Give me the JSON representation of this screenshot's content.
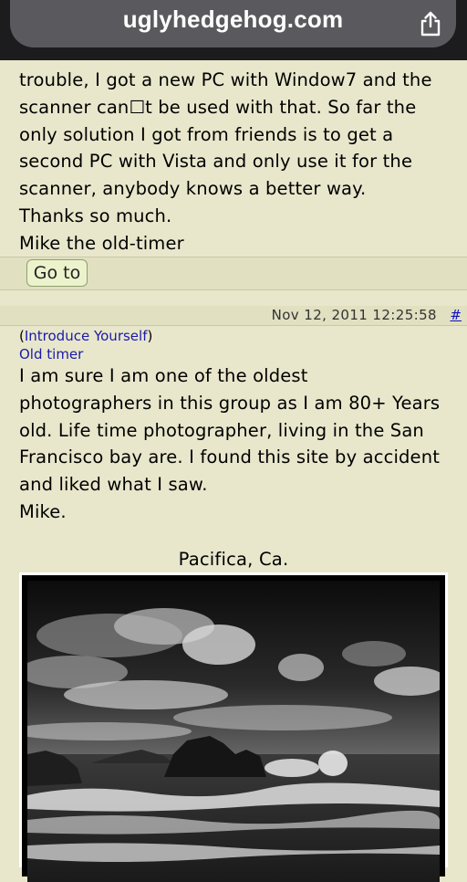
{
  "browser": {
    "url": "uglyhedgehog.com",
    "share_icon": "share-icon"
  },
  "previous_post": {
    "lines": [
      "trouble, I got a new PC with Window7 and the",
      "scanner can☐t be used with that. So far the",
      "only solution I got from friends is to get a",
      "second PC with Vista and only use it for the",
      "scanner, anybody knows a better way.",
      "Thanks so much.",
      "Mike the old-timer"
    ],
    "goto_label": "Go to"
  },
  "post": {
    "date": "Nov 12, 2011 12:25:58",
    "permalink": "#",
    "topic_open": "(",
    "topic": "Introduce Yourself",
    "topic_close": ")",
    "username": "Old timer",
    "lines": [
      "I am sure I am one of the oldest",
      "photographers in this group as I am 80+ Years",
      "old. Life time photographer, living in the San",
      "Francisco bay are. I found this site by accident",
      "and liked what I saw.",
      "Mike."
    ],
    "image_caption": "Pacifica, Ca."
  }
}
